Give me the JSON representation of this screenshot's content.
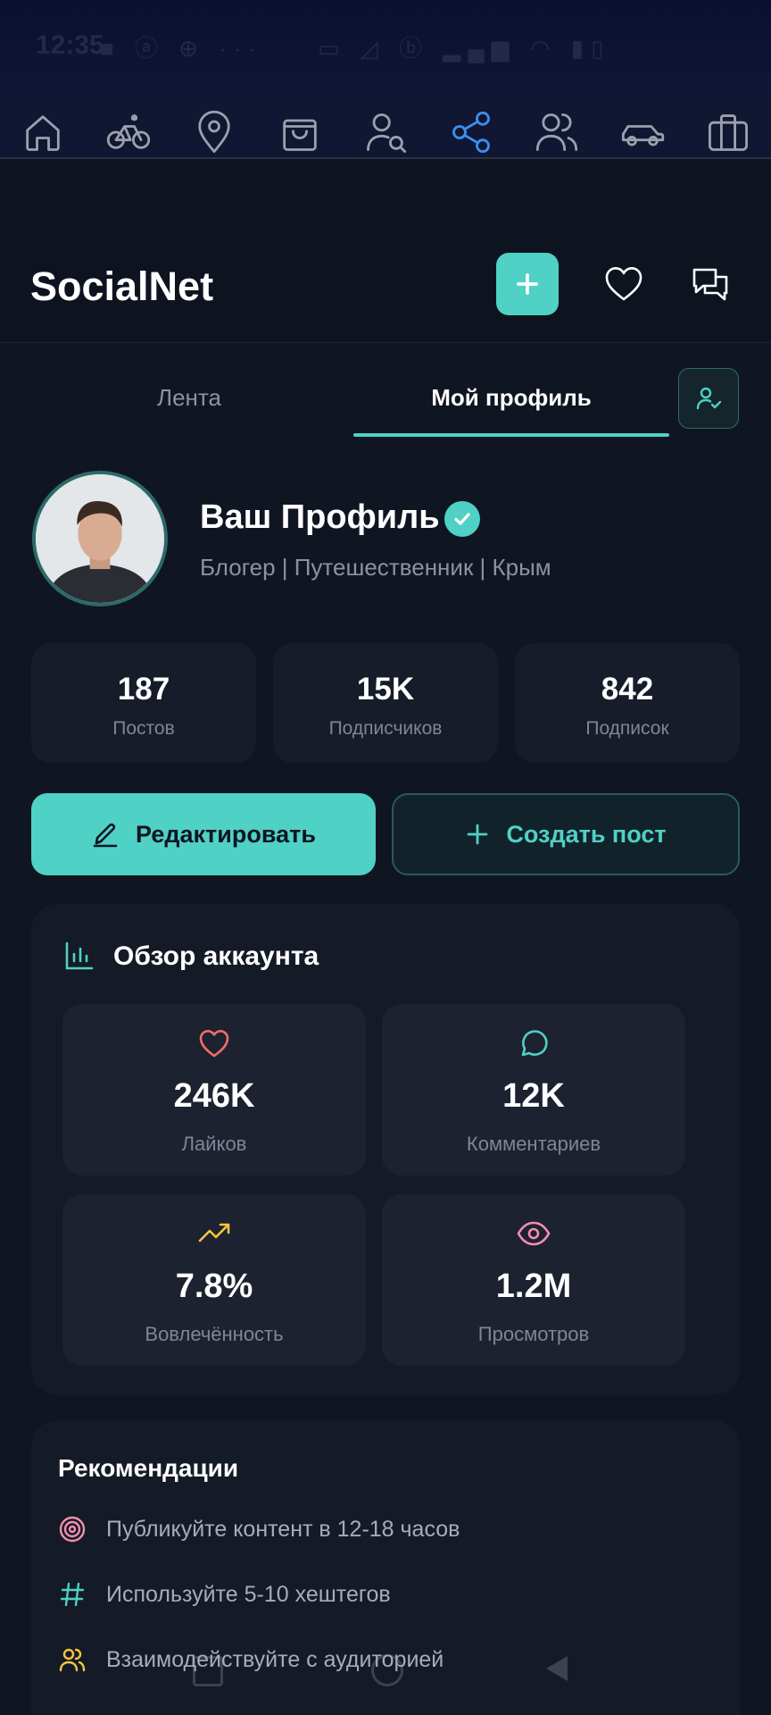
{
  "status_bar": {
    "time": "12:35",
    "icons_left": "■ ⓐ ⊕ ···",
    "icons_right": "▭ ◿ ⓑ ▂▄▆ ◠ ▮▯",
    "battery": "5"
  },
  "app_nav": {
    "items": [
      "home-icon",
      "bike-icon",
      "location-pin-icon",
      "shopping-bag-icon",
      "user-search-icon",
      "share-icon",
      "users-icon",
      "car-icon",
      "briefcase-icon"
    ],
    "active_index": 5,
    "active_color": "#3b8ff0"
  },
  "header": {
    "brand": "SocialNet",
    "icons": [
      "plus-icon",
      "heart-icon",
      "chat-icon"
    ],
    "accent": "#4fd1c5"
  },
  "tabs": [
    {
      "label": "Лента",
      "active": false
    },
    {
      "label": "Мой профиль",
      "active": true
    }
  ],
  "profile": {
    "name": "Ваш Профиль",
    "verified": true,
    "bio": "Блогер | Путешественник | Крым"
  },
  "stats": [
    {
      "value": "187",
      "label": "Постов"
    },
    {
      "value": "15K",
      "label": "Подписчиков"
    },
    {
      "value": "842",
      "label": "Подписок"
    }
  ],
  "actions": {
    "edit_label": "Редактировать",
    "create_label": "Создать пост"
  },
  "overview": {
    "title": "Обзор аккаунта",
    "metrics": [
      {
        "icon": "heart-icon",
        "value": "246K",
        "label": "Лайков",
        "color": "#f16b6b"
      },
      {
        "icon": "comment-icon",
        "value": "12K",
        "label": "Комментариев",
        "color": "#4fd1c5"
      },
      {
        "icon": "trending-up-icon",
        "value": "7.8%",
        "label": "Вовлечённость",
        "color": "#f5c542"
      },
      {
        "icon": "eye-icon",
        "value": "1.2M",
        "label": "Просмотров",
        "color": "#f48fb1"
      }
    ]
  },
  "recommendations": {
    "title": "Рекомендации",
    "items": [
      {
        "icon": "target-icon",
        "text": "Публикуйте контент в 12-18 часов",
        "color": "#f48fb1"
      },
      {
        "icon": "hashtag-icon",
        "text": "Используйте 5-10 хештегов",
        "color": "#4fd1c5"
      },
      {
        "icon": "users-icon",
        "text": "Взаимодействуйте с аудиторией",
        "color": "#f5c542"
      }
    ]
  }
}
